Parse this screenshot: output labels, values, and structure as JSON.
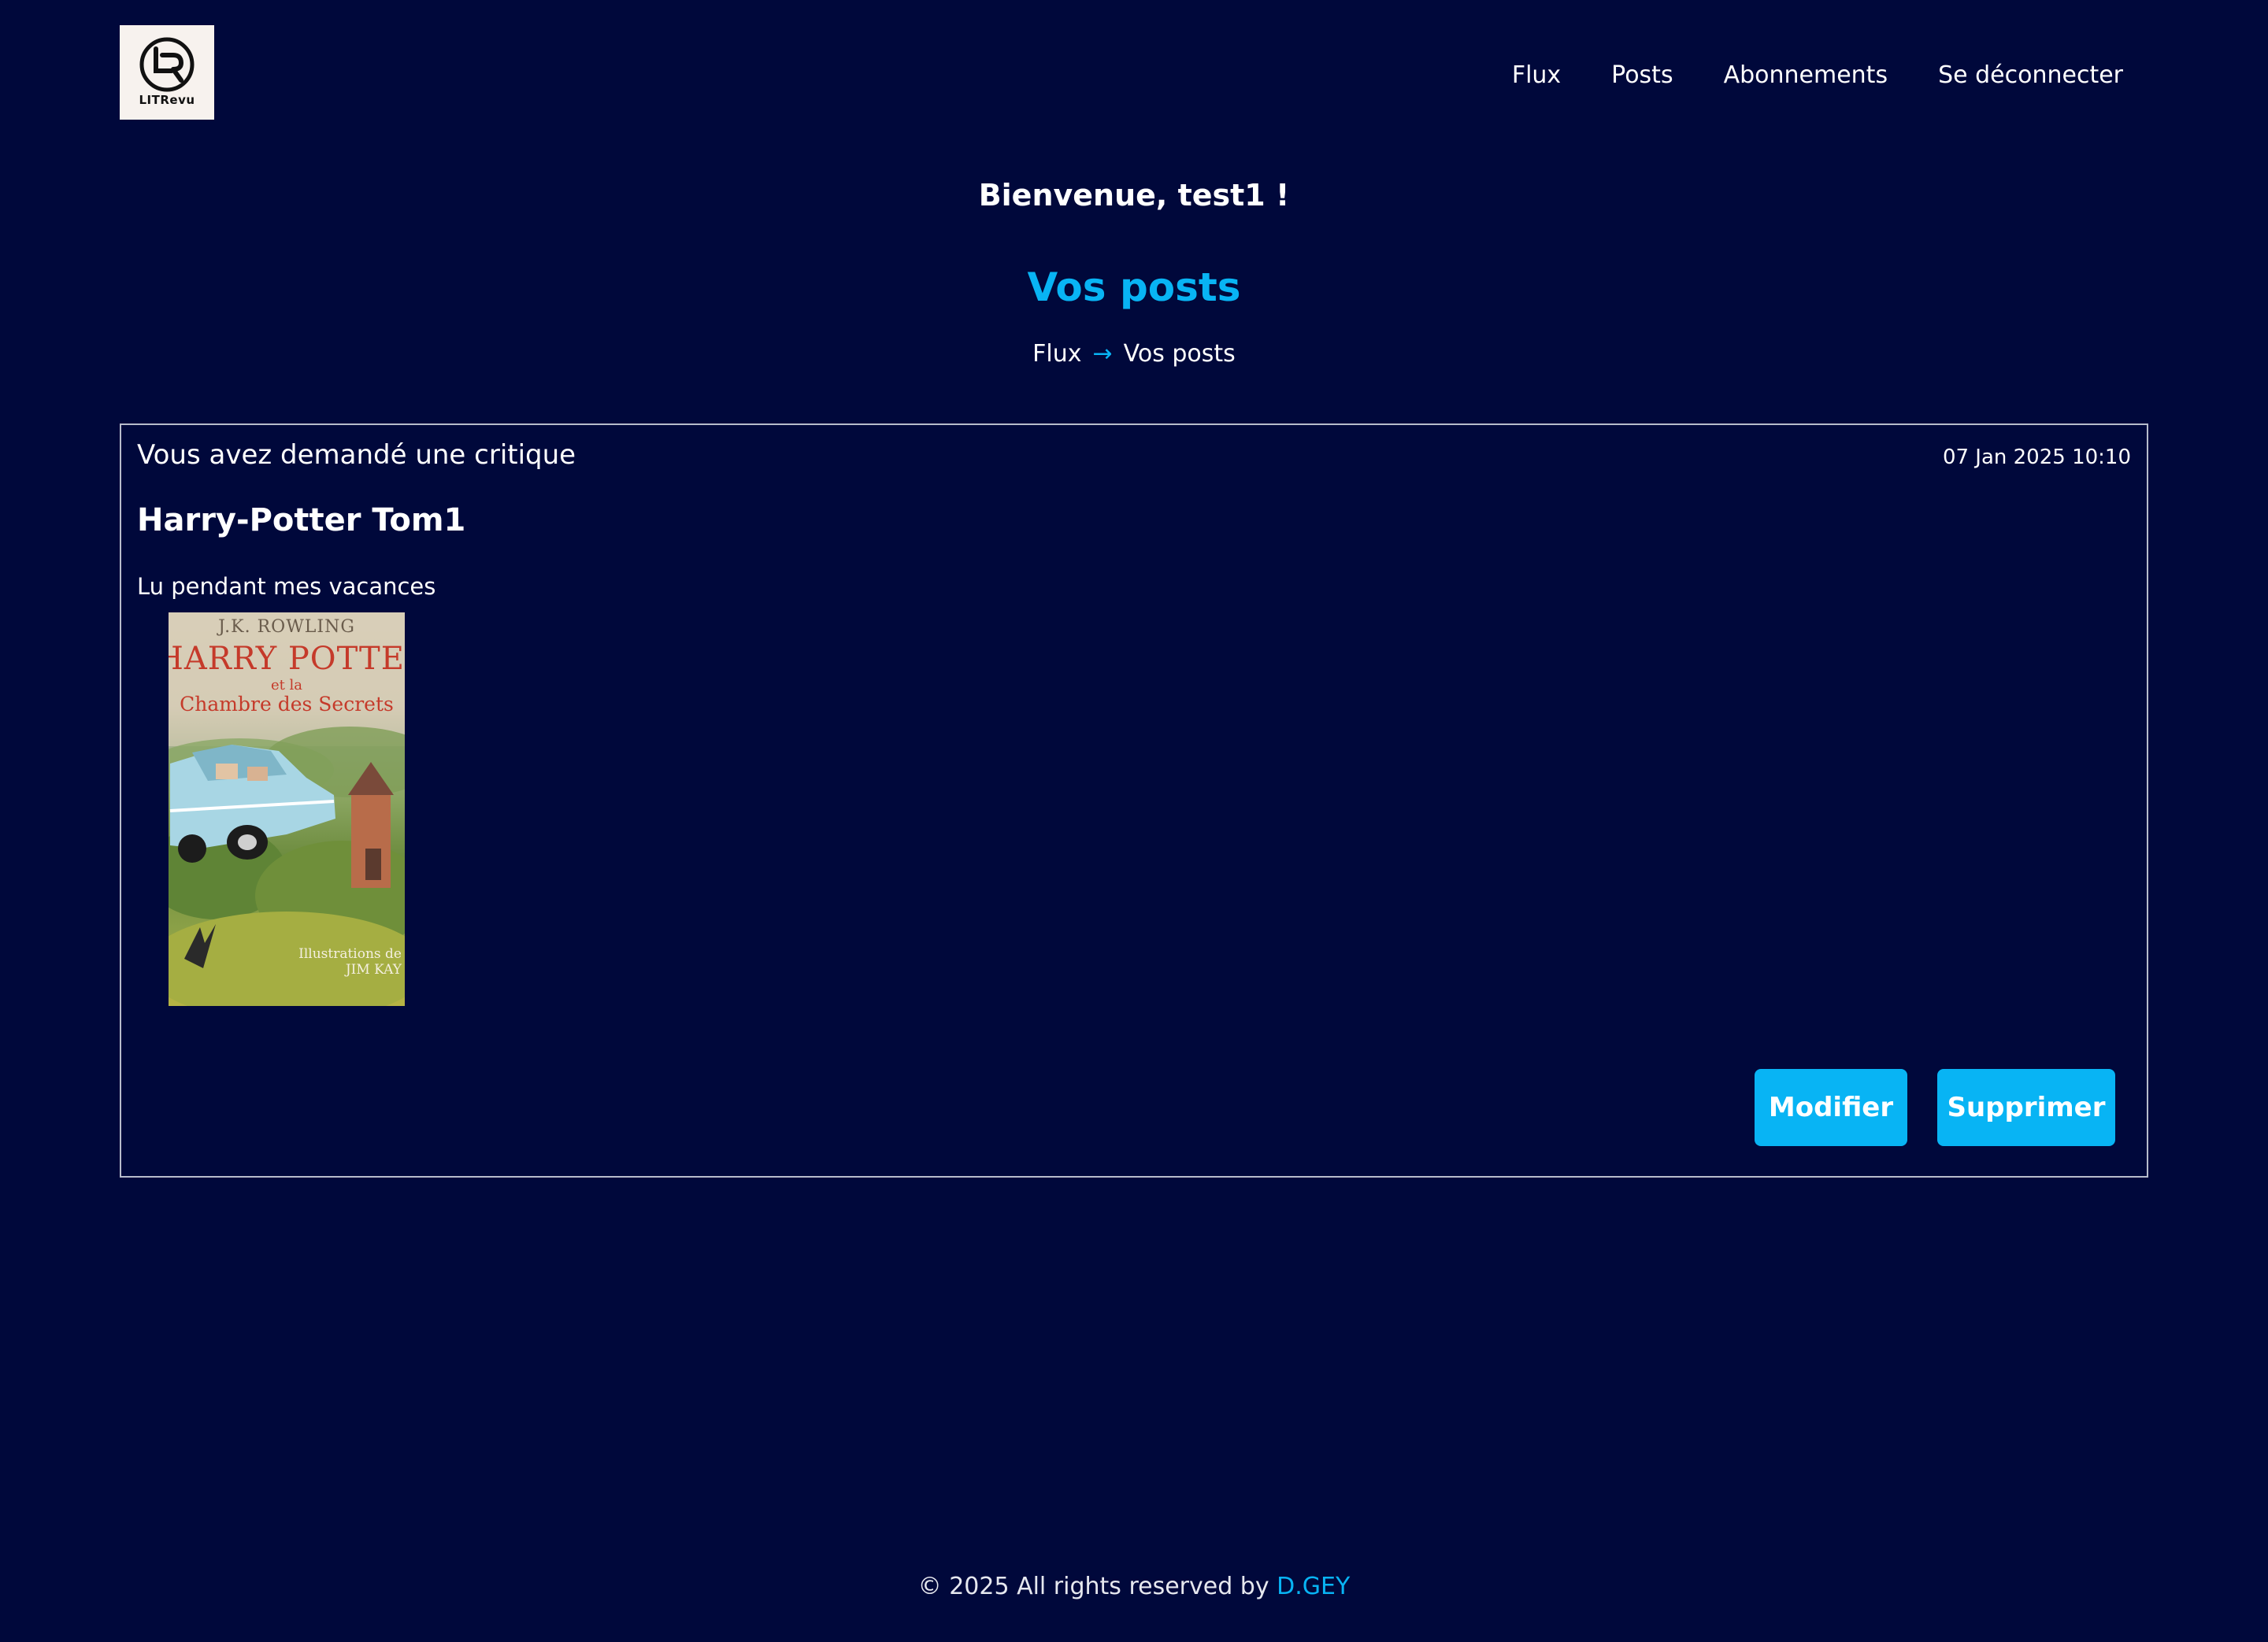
{
  "header": {
    "logo_text": "LITRevu",
    "nav": [
      {
        "label": "Flux"
      },
      {
        "label": "Posts"
      },
      {
        "label": "Abonnements"
      },
      {
        "label": "Se déconnecter"
      }
    ]
  },
  "welcome": "Bienvenue, test1 !",
  "section_title": "Vos posts",
  "breadcrumb": {
    "link": "Flux",
    "separator": "→",
    "current": "Vos posts"
  },
  "post": {
    "type": "Vous avez demandé une critique",
    "date": "07 Jan 2025 10:10",
    "title": "Harry-Potter Tom1",
    "description": "Lu pendant mes vacances",
    "cover": {
      "author": "J.K. ROWLING",
      "title": "HARRY POTTER",
      "subtitle_small": "et la",
      "subtitle": "Chambre des Secrets",
      "illustrations": "Illustrations de",
      "illustrator": "JIM KAY"
    },
    "edit_label": "Modifier",
    "delete_label": "Supprimer"
  },
  "footer": {
    "text": "© 2025 All rights reserved by",
    "author": "D.GEY"
  },
  "colors": {
    "background": "#00083b",
    "accent": "#08b4f4",
    "text": "#ffffff"
  }
}
